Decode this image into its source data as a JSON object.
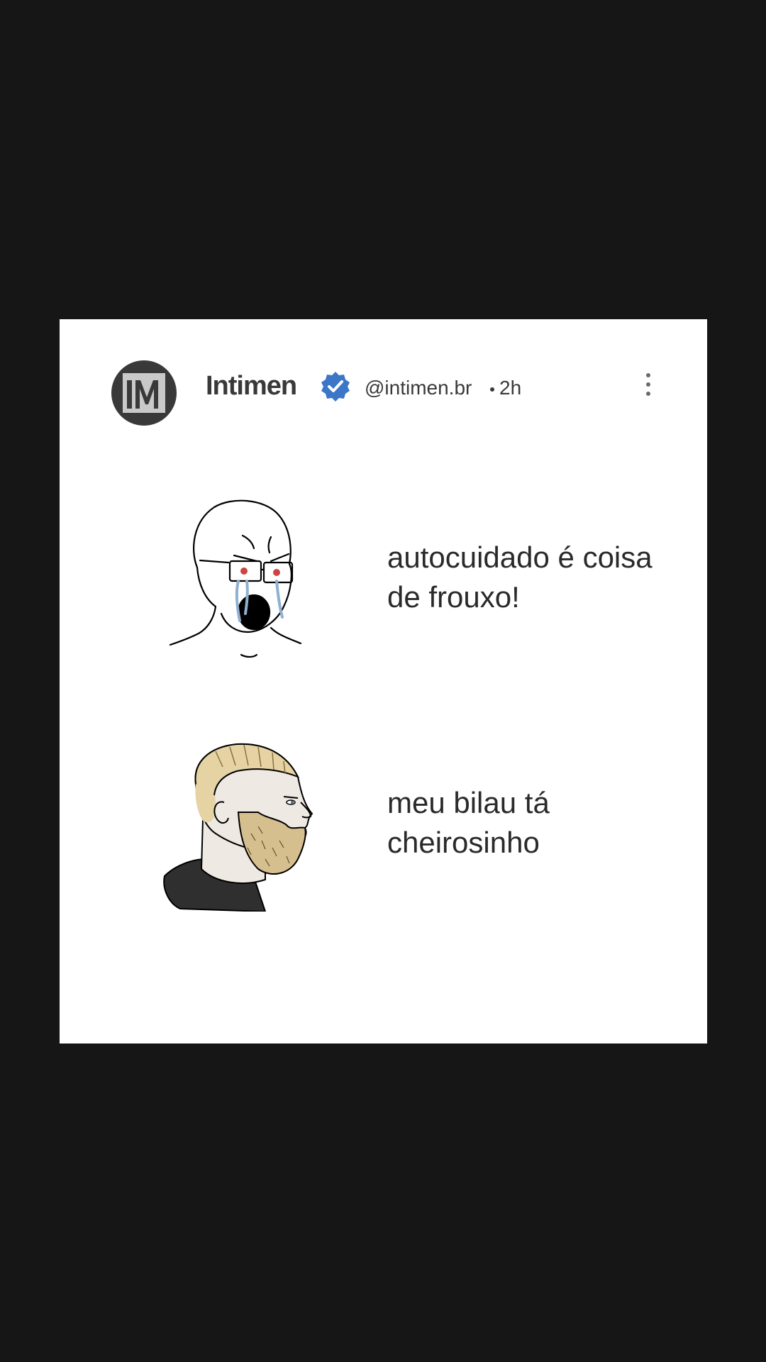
{
  "post": {
    "author_name": "Intimen",
    "avatar_text": "IM",
    "handle": "@intimen.br",
    "time": "2h",
    "icons": {
      "verified": "verified-badge-icon",
      "more": "more-options-icon"
    },
    "colors": {
      "background": "#161616",
      "card": "#ffffff",
      "verified": "#3b76c9",
      "avatar": "#3a3939"
    }
  },
  "meme": {
    "panels": [
      {
        "character": "crying-wojak",
        "caption": "autocuidado é coisa de frouxo!"
      },
      {
        "character": "yes-chad",
        "caption": "meu bilau tá cheirosinho"
      }
    ]
  }
}
